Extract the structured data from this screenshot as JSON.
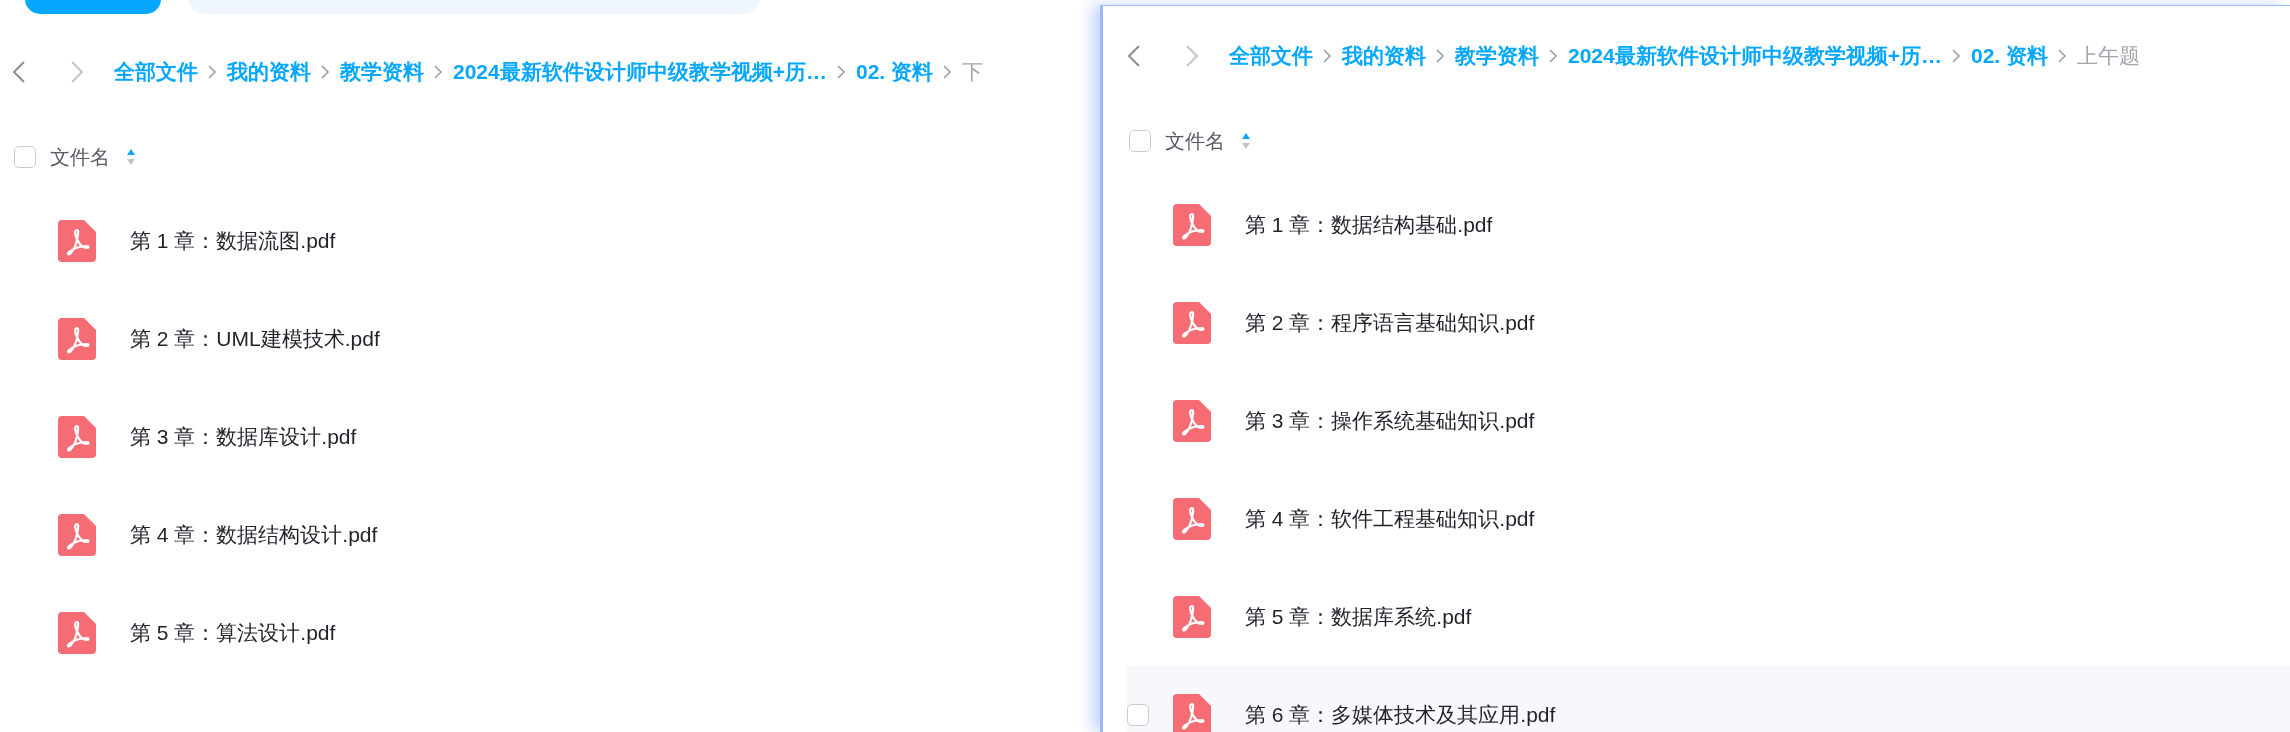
{
  "left_window": {
    "breadcrumb": [
      {
        "label": "全部文件",
        "current": false
      },
      {
        "label": "我的资料",
        "current": false
      },
      {
        "label": "教学资料",
        "current": false
      },
      {
        "label": "2024最新软件设计师中级教学视频+历…",
        "current": false
      },
      {
        "label": "02. 资料",
        "current": false
      },
      {
        "label": "下",
        "current": true
      }
    ],
    "header": {
      "checked": false,
      "label": "文件名",
      "sorted_ascending": true
    },
    "files": [
      {
        "name": "第 1 章：数据流图.pdf",
        "hovered": false
      },
      {
        "name": "第 2 章：UML建模技术.pdf",
        "hovered": false
      },
      {
        "name": "第 3 章：数据库设计.pdf",
        "hovered": false
      },
      {
        "name": "第 4 章：数据结构设计.pdf",
        "hovered": false
      },
      {
        "name": "第 5 章：算法设计.pdf",
        "hovered": false
      }
    ]
  },
  "right_window": {
    "breadcrumb": [
      {
        "label": "全部文件",
        "current": false
      },
      {
        "label": "我的资料",
        "current": false
      },
      {
        "label": "教学资料",
        "current": false
      },
      {
        "label": "2024最新软件设计师中级教学视频+历…",
        "current": false
      },
      {
        "label": "02. 资料",
        "current": false
      },
      {
        "label": "上午题",
        "current": true
      }
    ],
    "header": {
      "checked": false,
      "label": "文件名",
      "sorted_ascending": true
    },
    "files": [
      {
        "name": "第 1 章：数据结构基础.pdf",
        "hovered": false
      },
      {
        "name": "第 2 章：程序语言基础知识.pdf",
        "hovered": false
      },
      {
        "name": "第 3 章：操作系统基础知识.pdf",
        "hovered": false
      },
      {
        "name": "第 4 章：软件工程基础知识.pdf",
        "hovered": false
      },
      {
        "name": "第 5 章：数据库系统.pdf",
        "hovered": false
      },
      {
        "name": "第 6 章：多媒体技术及其应用.pdf",
        "hovered": true
      }
    ]
  }
}
